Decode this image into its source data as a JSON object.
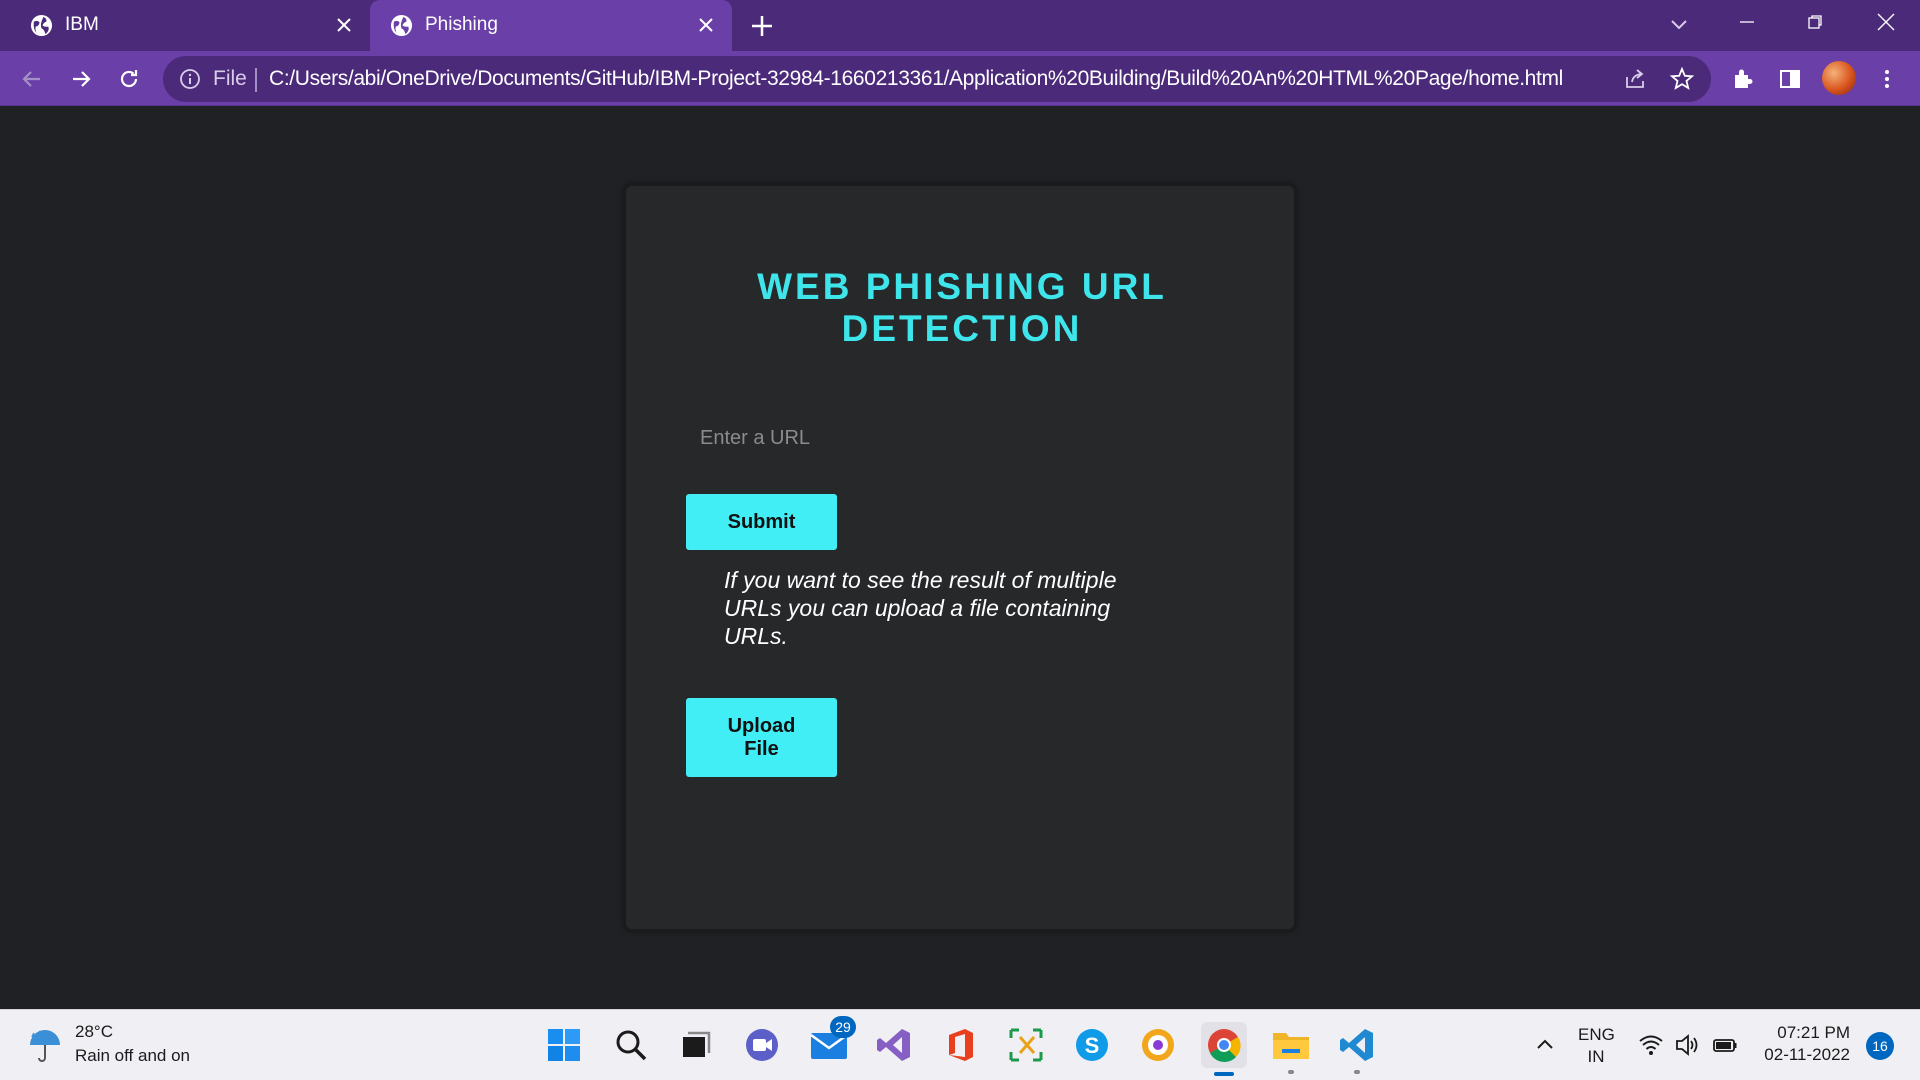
{
  "browser": {
    "tabs": [
      {
        "title": "IBM",
        "icon": "globe-icon"
      },
      {
        "title": "Phishing",
        "icon": "globe-icon",
        "active": true
      }
    ],
    "omnibox": {
      "scheme": "File",
      "url": "C:/Users/abi/OneDrive/Documents/GitHub/IBM-Project-32984-1660213361/Application%20Building/Build%20An%20HTML%20Page/home.html"
    },
    "colors": {
      "frame": "#4b2a7a",
      "toolbar": "#6b3fa8"
    }
  },
  "page": {
    "title_line1": "WEB PHISHING URL",
    "title_line2": "DETECTION",
    "url_input_placeholder": "Enter a URL",
    "submit_label": "Submit",
    "hint": "If you want to see the result of multiple URLs you can upload a file containing URLs.",
    "upload_label": "Upload File",
    "colors": {
      "accent": "#42eef6",
      "title": "#3ee6ec",
      "background": "#202124",
      "card": "#26282a"
    }
  },
  "taskbar": {
    "weather": {
      "temp": "28°C",
      "desc": "Rain off and on"
    },
    "apps": [
      {
        "name": "start",
        "icon": "windows-start-icon"
      },
      {
        "name": "search",
        "icon": "search-icon"
      },
      {
        "name": "task-view",
        "icon": "task-view-icon"
      },
      {
        "name": "chat",
        "icon": "chat-icon"
      },
      {
        "name": "mail",
        "icon": "mail-icon",
        "badge": "29"
      },
      {
        "name": "visual-studio",
        "icon": "visual-studio-icon"
      },
      {
        "name": "office",
        "icon": "office-icon"
      },
      {
        "name": "snipping",
        "icon": "snipping-tool-icon"
      },
      {
        "name": "skype",
        "icon": "skype-icon"
      },
      {
        "name": "vpn",
        "icon": "vpn-icon"
      },
      {
        "name": "chrome",
        "icon": "chrome-icon",
        "active": true
      },
      {
        "name": "file-explorer",
        "icon": "folder-icon"
      },
      {
        "name": "vscode",
        "icon": "vscode-icon"
      }
    ],
    "tray": {
      "lang_line1": "ENG",
      "lang_line2": "IN",
      "time": "07:21 PM",
      "date": "02-11-2022",
      "notifications": "16"
    }
  }
}
